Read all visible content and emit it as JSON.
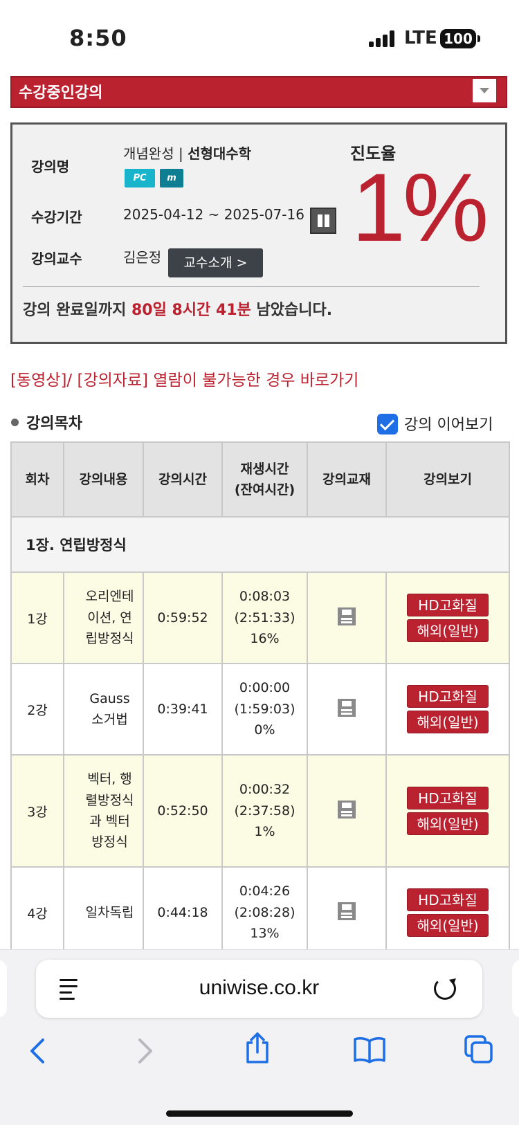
{
  "status": {
    "time": "8:50",
    "network": "LTE",
    "battery": "100"
  },
  "course_select": {
    "label": "수강중인강의"
  },
  "info": {
    "name_label": "강의명",
    "name_prefix": "개념완성 | ",
    "name_bold": "선형대수학",
    "badge_pc": "PC",
    "badge_mobile": "m",
    "period_label": "수강기간",
    "period_value": "2025-04-12 ~ 2025-07-16",
    "professor_label": "강의교수",
    "professor_name": "김은정",
    "professor_button": "교수소개 >",
    "progress_label": "진도율",
    "progress_value": "1%",
    "remain_prefix": "강의 완료일까지 ",
    "remain_highlight": "80일 8시간 41분",
    "remain_suffix": " 남았습니다."
  },
  "help_link": "[동영상]/ [강의자료] 열람이 불가능한 경우 바로가기",
  "toc": {
    "title": "강의목차",
    "continue_label": "강의 이어보기",
    "continue_checked": true
  },
  "table": {
    "headers": {
      "no": "회차",
      "content": "강의내용",
      "duration": "강의시간",
      "play_line1": "재생시간",
      "play_line2": "(잔여시간)",
      "book": "강의교재",
      "view": "강의보기"
    },
    "chapter": "1장. 연립방정식",
    "btn_hd": "HD고화질",
    "btn_overseas": "해외(일반)",
    "rows": [
      {
        "no": "1강",
        "content": [
          "오리엔테",
          "이션, 연",
          "립방정식"
        ],
        "duration": "0:59:52",
        "played": "0:08:03",
        "remaining": "(2:51:33)",
        "percent": "16%"
      },
      {
        "no": "2강",
        "content": [
          "Gauss",
          "소거법"
        ],
        "duration": "0:39:41",
        "played": "0:00:00",
        "remaining": "(1:59:03)",
        "percent": "0%"
      },
      {
        "no": "3강",
        "content": [
          "벡터, 행",
          "렬방정식",
          "과 벡터",
          "방정식"
        ],
        "duration": "0:52:50",
        "played": "0:00:32",
        "remaining": "(2:37:58)",
        "percent": "1%"
      },
      {
        "no": "4강",
        "content": [
          "일차독립"
        ],
        "duration": "0:44:18",
        "played": "0:04:26",
        "remaining": "(2:08:28)",
        "percent": "13%"
      }
    ]
  },
  "browser": {
    "url": "uniwise.co.kr"
  }
}
